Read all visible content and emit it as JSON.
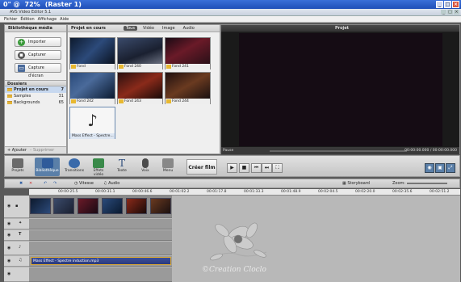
{
  "os_title": {
    "prefix": "0\" @",
    "zoom": "72%",
    "layer": "(Raster 1)"
  },
  "app": {
    "title": "AVS Video Editor 5.1"
  },
  "menu": [
    "Fichier",
    "Édition",
    "Affichage",
    "Aide"
  ],
  "library": {
    "header": "Bibliothèque média",
    "buttons": [
      "Importer",
      "Capturer",
      "Capture d'écran"
    ],
    "folders_header": "Dossiers",
    "folders": [
      {
        "name": "Projet en cours",
        "count": "7"
      },
      {
        "name": "Samples",
        "count": "31"
      },
      {
        "name": "Backgrounds",
        "count": "65"
      }
    ],
    "add": "+ Ajouter",
    "remove": "– Supprimer"
  },
  "project": {
    "header": "Projet en cours",
    "filters": [
      "Tous",
      "Vidéo",
      "Image",
      "Audio"
    ],
    "items": [
      "Fond",
      "Fond 240",
      "Fond 241",
      "Fond 242",
      "Fond 243",
      "Fond 244",
      "Mass Effect - Spectre..."
    ]
  },
  "preview": {
    "header": "Projet",
    "status": "Pause",
    "time": "00:00:00.000 / 00:00:00.000"
  },
  "toolbar": {
    "buttons": [
      "Projets",
      "Bibliothèque",
      "Transitions",
      "Effets vidéo",
      "Texte",
      "Voix",
      "Menu"
    ],
    "create": "Créer film"
  },
  "timeline": {
    "labels": {
      "view": "Vitesse",
      "audio": "Audio",
      "storyboard": "Storyboard",
      "zoom": "Zoom:"
    },
    "ruler": [
      "00:00:25.5",
      "00:00:31.1",
      "00:00:46.6",
      "00:01:02.2",
      "00:01:17.8",
      "00:01:33.3",
      "00:01:48.9",
      "00:02:04.5",
      "00:02:20.0",
      "00:02:35.6",
      "00:02:51.2"
    ],
    "audio_clip": "Mass Effect - Spectre induction.mp3"
  },
  "watermark": "©Creation Cloclo"
}
